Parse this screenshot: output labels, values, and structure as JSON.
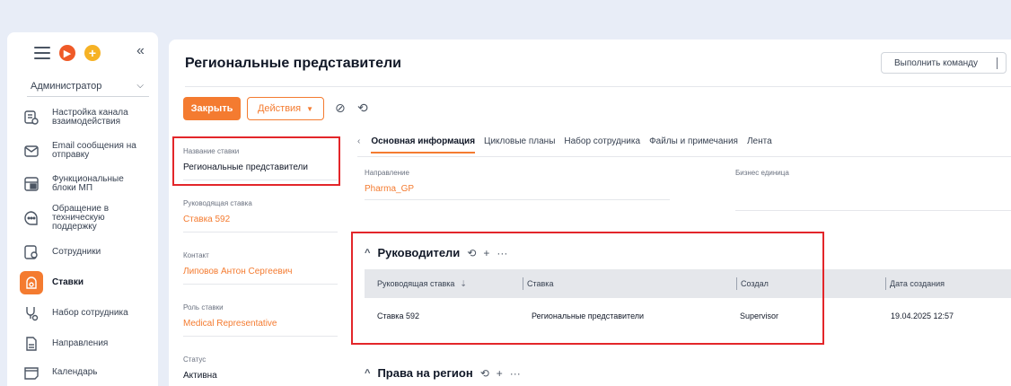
{
  "sidebar": {
    "role": "Администратор",
    "items": [
      {
        "label": "Настройка канала взаимодействия",
        "icon": "channel-settings-icon"
      },
      {
        "label": "Email сообщения на отправку",
        "icon": "email-icon"
      },
      {
        "label": "Функциональные блоки МП",
        "icon": "blocks-icon"
      },
      {
        "label": "Обращение в техническую поддержку",
        "icon": "support-chat-icon"
      },
      {
        "label": "Сотрудники",
        "icon": "employees-icon"
      },
      {
        "label": "Ставки",
        "icon": "rates-icon"
      },
      {
        "label": "Набор сотрудника",
        "icon": "hiring-icon"
      },
      {
        "label": "Направления",
        "icon": "directions-icon"
      },
      {
        "label": "Календарь",
        "icon": "calendar-icon"
      }
    ]
  },
  "header": {
    "title": "Региональные представители",
    "command_placeholder": "Выполнить команду"
  },
  "toolbar": {
    "close_label": "Закрыть",
    "actions_label": "Действия"
  },
  "left_panel": {
    "fields": [
      {
        "label": "Название ставки",
        "value": "Региональные представители"
      },
      {
        "label": "Руководящая ставка",
        "value": "Ставка 592"
      },
      {
        "label": "Контакт",
        "value": "Липовов Антон Сергеевич"
      },
      {
        "label": "Роль ставки",
        "value": "Medical Representative"
      },
      {
        "label": "Статус",
        "value": "Активна"
      }
    ]
  },
  "tabs": [
    "Основная информация",
    "Цикловые планы",
    "Набор сотрудника",
    "Файлы и примечания",
    "Лента"
  ],
  "main_fields": {
    "direction_label": "Направление",
    "direction_value": "Pharma_GP",
    "business_unit_label": "Бизнес единица",
    "business_unit_value": ""
  },
  "managers_section": {
    "title": "Руководители",
    "columns": [
      "Руководящая ставка",
      "Ставка",
      "Создал",
      "Дата создания"
    ],
    "rows": [
      {
        "lead_rate": "Ставка 592",
        "rate": "Региональные представители",
        "created_by": "Supervisor",
        "created_at": "19.04.2025 12:57"
      }
    ]
  },
  "region_section": {
    "title": "Права на регион"
  },
  "colors": {
    "accent": "#f47b30",
    "highlight": "#e3262a"
  }
}
